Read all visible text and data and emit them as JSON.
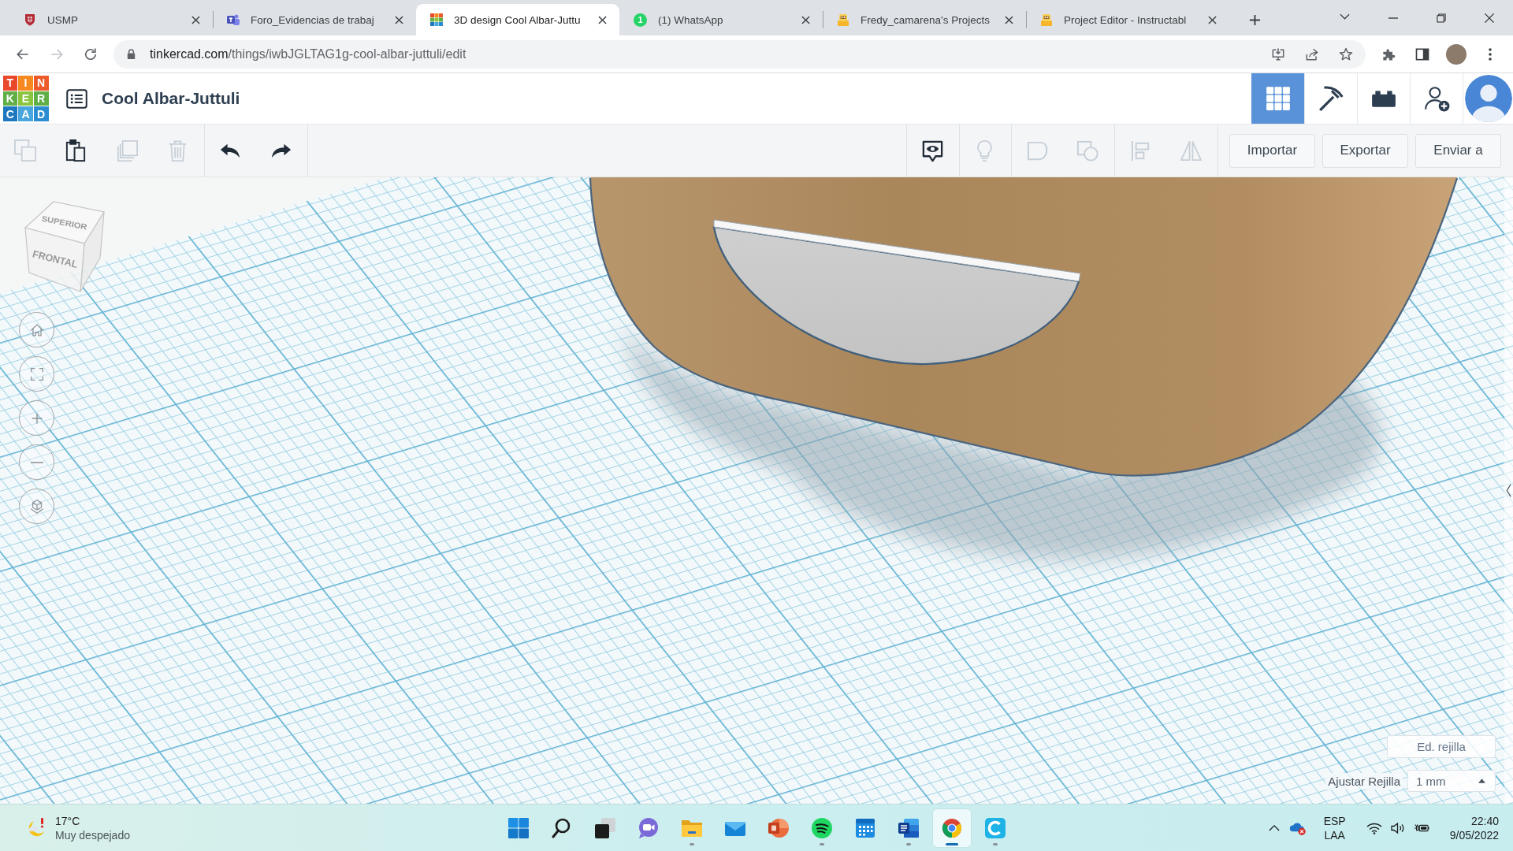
{
  "browser": {
    "tabs": [
      {
        "title": "USMP",
        "kind": "crest",
        "selected": false
      },
      {
        "title": "Foro_Evidencias de trabaj",
        "kind": "teams",
        "selected": false
      },
      {
        "title": "3D design Cool Albar-Juttu",
        "kind": "tinkercad",
        "selected": true
      },
      {
        "title": "(1) WhatsApp",
        "kind": "badge",
        "badge": "1",
        "selected": false
      },
      {
        "title": "Fredy_camarena's Projects",
        "kind": "robot",
        "selected": false
      },
      {
        "title": "Project Editor - Instructabl",
        "kind": "robot",
        "selected": false
      }
    ],
    "nav": [
      {
        "kind": "back",
        "disabled": false
      },
      {
        "kind": "forward",
        "disabled": true
      },
      {
        "kind": "reload",
        "disabled": false
      }
    ],
    "address": {
      "host": "tinkercad.com",
      "path": "/things/iwbJGLTAG1g-cool-albar-juttuli/edit"
    }
  },
  "app": {
    "logo": [
      [
        "T",
        "I",
        "N"
      ],
      [
        "K",
        "E",
        "R"
      ],
      [
        "C",
        "A",
        "D"
      ]
    ],
    "design_title": "Cool Albar-Juttuli",
    "header_tools": [
      {
        "kind": "grid",
        "selected": true
      },
      {
        "kind": "pickaxe",
        "selected": false
      },
      {
        "kind": "bricks",
        "selected": false
      },
      {
        "kind": "add_user",
        "selected": false
      }
    ]
  },
  "toolbar": {
    "left_groups": [
      [
        {
          "kind": "copy",
          "disabled": true
        },
        {
          "kind": "paste",
          "disabled": false
        },
        {
          "kind": "duplicate",
          "disabled": true
        },
        {
          "kind": "delete",
          "disabled": true
        }
      ],
      [
        {
          "kind": "undo",
          "disabled": false
        },
        {
          "kind": "redo",
          "disabled": false
        }
      ]
    ],
    "right_groups": [
      [
        {
          "kind": "notes",
          "disabled": false
        }
      ],
      [
        {
          "kind": "light",
          "disabled": true
        }
      ],
      [
        {
          "kind": "group",
          "disabled": true
        },
        {
          "kind": "hole",
          "disabled": true
        }
      ],
      [
        {
          "kind": "align",
          "disabled": true
        },
        {
          "kind": "mirror",
          "disabled": true
        }
      ]
    ],
    "buttons": [
      "Importar",
      "Exportar",
      "Enviar a"
    ]
  },
  "workplane": {
    "view_cube": [
      "SUPERIOR",
      "FRONTAL"
    ],
    "nav_buttons": [
      {
        "kind": "home"
      },
      {
        "kind": "fit"
      },
      {
        "kind": "zoom_in"
      },
      {
        "kind": "zoom_out"
      },
      {
        "kind": "perspective"
      }
    ],
    "edit_grid": "Ed. rejilla",
    "snap_label": "Ajustar Rejilla",
    "snap_value": "1 mm"
  },
  "taskbar": {
    "weather": {
      "temperature": "17°C",
      "condition": "Muy despejado"
    },
    "apps": [
      {
        "kind": "start",
        "running": false,
        "selected": false
      },
      {
        "kind": "search",
        "running": false,
        "selected": false
      },
      {
        "kind": "task_view",
        "running": false,
        "selected": false
      },
      {
        "kind": "chat",
        "running": false,
        "selected": false
      },
      {
        "kind": "files",
        "running": true,
        "selected": false
      },
      {
        "kind": "mail",
        "running": false,
        "selected": false
      },
      {
        "kind": "slides",
        "running": false,
        "selected": false
      },
      {
        "kind": "music",
        "running": true,
        "selected": false
      },
      {
        "kind": "calendar",
        "running": false,
        "selected": false
      },
      {
        "kind": "document",
        "running": true,
        "selected": false
      },
      {
        "kind": "browser",
        "running": true,
        "selected": true
      },
      {
        "kind": "c_app",
        "running": true,
        "selected": false
      }
    ],
    "tray": {
      "language": "ESP",
      "layout": "LAA",
      "time": "22:40",
      "date": "9/05/2022"
    }
  }
}
